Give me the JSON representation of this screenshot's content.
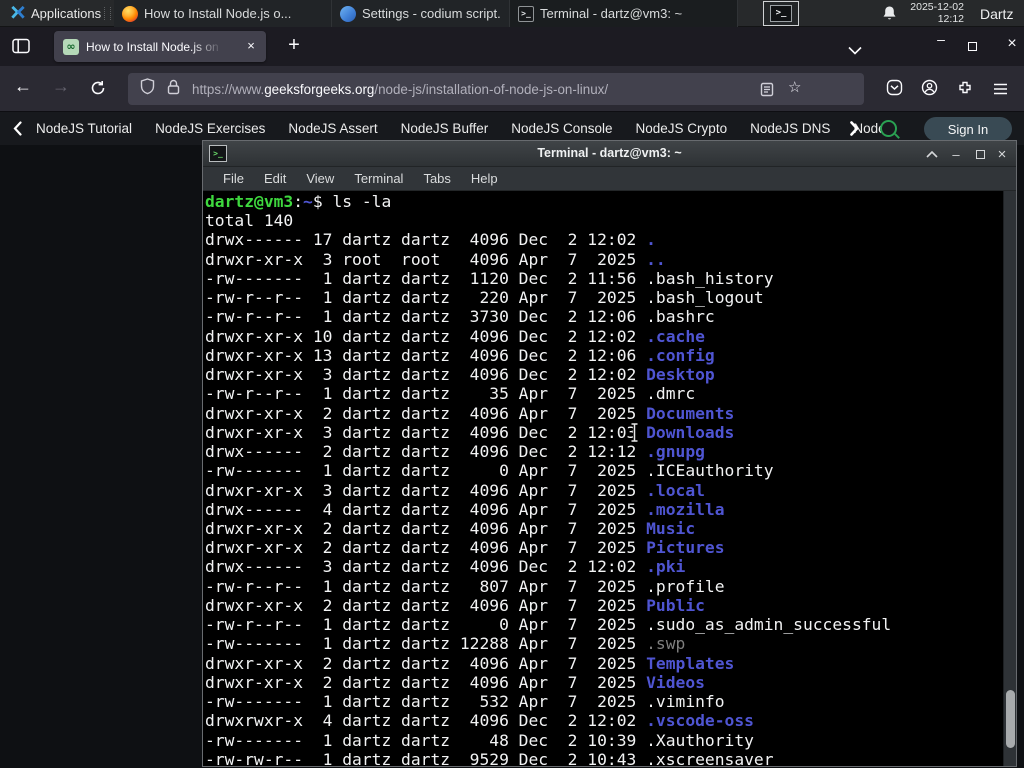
{
  "colors": {
    "accent_green": "#2aa152",
    "dir_blue": "#4f55d2",
    "prompt_green": "#3ed83e",
    "dim_file_gray": "#7f7f7f",
    "terminal_bg": "#000000",
    "panel_bg": "#27292b",
    "firefox_chrome_bg": "#2b2a33"
  },
  "panel": {
    "applications_label": "Applications",
    "windows": [
      {
        "title": "How to Install Node.js o...",
        "icon": "firefox",
        "active": false
      },
      {
        "title": "Settings - codium script...",
        "icon": "vscodium",
        "active": false
      },
      {
        "title": "Terminal - dartz@vm3: ~",
        "icon": "terminal",
        "active": true
      }
    ],
    "clock_date": "2025-12-02",
    "clock_time": "12:12",
    "user": "Dartz"
  },
  "browser": {
    "tab_title": "How to Install Node.js on",
    "tab_close_glyph": "×",
    "new_tab_glyph": "+",
    "back_glyph": "←",
    "forward_glyph": "→",
    "min_glyph": "–",
    "close_glyph": "×",
    "star_glyph": "☆",
    "favicon_glyph": "∞",
    "url": {
      "scheme": "https://www.",
      "domain": "geeksforgeeks.org",
      "path": "/node-js/installation-of-node-js-on-linux/"
    }
  },
  "site_nav": {
    "items": [
      "NodeJS Tutorial",
      "NodeJS Exercises",
      "NodeJS Assert",
      "NodeJS Buffer",
      "NodeJS Console",
      "NodeJS Crypto",
      "NodeJS DNS",
      "Node"
    ],
    "sign_in_label": "Sign In"
  },
  "terminal": {
    "window_title": "Terminal - dartz@vm3: ~",
    "icon_glyph": ">_",
    "min_glyph": "–",
    "close_glyph": "×",
    "menu_items": [
      "File",
      "Edit",
      "View",
      "Terminal",
      "Tabs",
      "Help"
    ],
    "prompt_userhost": "dartz@vm3",
    "prompt_separator": ":",
    "prompt_cwd": "~",
    "prompt_command": "ls -la",
    "total_line": "total 140",
    "listing": [
      {
        "perms": "drwx------",
        "links": "17",
        "owner": "dartz",
        "group": "dartz",
        "size": "4096",
        "month": "Dec",
        "day": "2",
        "when": "12:02",
        "name": ".",
        "type": "dir"
      },
      {
        "perms": "drwxr-xr-x",
        "links": "3",
        "owner": "root",
        "group": "root",
        "size": "4096",
        "month": "Apr",
        "day": "7",
        "when": "2025",
        "name": "..",
        "type": "dir"
      },
      {
        "perms": "-rw-------",
        "links": "1",
        "owner": "dartz",
        "group": "dartz",
        "size": "1120",
        "month": "Dec",
        "day": "2",
        "when": "11:56",
        "name": ".bash_history",
        "type": "file"
      },
      {
        "perms": "-rw-r--r--",
        "links": "1",
        "owner": "dartz",
        "group": "dartz",
        "size": "220",
        "month": "Apr",
        "day": "7",
        "when": "2025",
        "name": ".bash_logout",
        "type": "file"
      },
      {
        "perms": "-rw-r--r--",
        "links": "1",
        "owner": "dartz",
        "group": "dartz",
        "size": "3730",
        "month": "Dec",
        "day": "2",
        "when": "12:06",
        "name": ".bashrc",
        "type": "file"
      },
      {
        "perms": "drwxr-xr-x",
        "links": "10",
        "owner": "dartz",
        "group": "dartz",
        "size": "4096",
        "month": "Dec",
        "day": "2",
        "when": "12:02",
        "name": ".cache",
        "type": "dir"
      },
      {
        "perms": "drwxr-xr-x",
        "links": "13",
        "owner": "dartz",
        "group": "dartz",
        "size": "4096",
        "month": "Dec",
        "day": "2",
        "when": "12:06",
        "name": ".config",
        "type": "dir"
      },
      {
        "perms": "drwxr-xr-x",
        "links": "3",
        "owner": "dartz",
        "group": "dartz",
        "size": "4096",
        "month": "Dec",
        "day": "2",
        "when": "12:02",
        "name": "Desktop",
        "type": "dir"
      },
      {
        "perms": "-rw-r--r--",
        "links": "1",
        "owner": "dartz",
        "group": "dartz",
        "size": "35",
        "month": "Apr",
        "day": "7",
        "when": "2025",
        "name": ".dmrc",
        "type": "file"
      },
      {
        "perms": "drwxr-xr-x",
        "links": "2",
        "owner": "dartz",
        "group": "dartz",
        "size": "4096",
        "month": "Apr",
        "day": "7",
        "when": "2025",
        "name": "Documents",
        "type": "dir"
      },
      {
        "perms": "drwxr-xr-x",
        "links": "3",
        "owner": "dartz",
        "group": "dartz",
        "size": "4096",
        "month": "Dec",
        "day": "2",
        "when": "12:03",
        "name": "Downloads",
        "type": "dir"
      },
      {
        "perms": "drwx------",
        "links": "2",
        "owner": "dartz",
        "group": "dartz",
        "size": "4096",
        "month": "Dec",
        "day": "2",
        "when": "12:12",
        "name": ".gnupg",
        "type": "dir"
      },
      {
        "perms": "-rw-------",
        "links": "1",
        "owner": "dartz",
        "group": "dartz",
        "size": "0",
        "month": "Apr",
        "day": "7",
        "when": "2025",
        "name": ".ICEauthority",
        "type": "file"
      },
      {
        "perms": "drwxr-xr-x",
        "links": "3",
        "owner": "dartz",
        "group": "dartz",
        "size": "4096",
        "month": "Apr",
        "day": "7",
        "when": "2025",
        "name": ".local",
        "type": "dir"
      },
      {
        "perms": "drwx------",
        "links": "4",
        "owner": "dartz",
        "group": "dartz",
        "size": "4096",
        "month": "Apr",
        "day": "7",
        "when": "2025",
        "name": ".mozilla",
        "type": "dir"
      },
      {
        "perms": "drwxr-xr-x",
        "links": "2",
        "owner": "dartz",
        "group": "dartz",
        "size": "4096",
        "month": "Apr",
        "day": "7",
        "when": "2025",
        "name": "Music",
        "type": "dir"
      },
      {
        "perms": "drwxr-xr-x",
        "links": "2",
        "owner": "dartz",
        "group": "dartz",
        "size": "4096",
        "month": "Apr",
        "day": "7",
        "when": "2025",
        "name": "Pictures",
        "type": "dir"
      },
      {
        "perms": "drwx------",
        "links": "3",
        "owner": "dartz",
        "group": "dartz",
        "size": "4096",
        "month": "Dec",
        "day": "2",
        "when": "12:02",
        "name": ".pki",
        "type": "dir"
      },
      {
        "perms": "-rw-r--r--",
        "links": "1",
        "owner": "dartz",
        "group": "dartz",
        "size": "807",
        "month": "Apr",
        "day": "7",
        "when": "2025",
        "name": ".profile",
        "type": "file"
      },
      {
        "perms": "drwxr-xr-x",
        "links": "2",
        "owner": "dartz",
        "group": "dartz",
        "size": "4096",
        "month": "Apr",
        "day": "7",
        "when": "2025",
        "name": "Public",
        "type": "dir"
      },
      {
        "perms": "-rw-r--r--",
        "links": "1",
        "owner": "dartz",
        "group": "dartz",
        "size": "0",
        "month": "Apr",
        "day": "7",
        "when": "2025",
        "name": ".sudo_as_admin_successful",
        "type": "file"
      },
      {
        "perms": "-rw-------",
        "links": "1",
        "owner": "dartz",
        "group": "dartz",
        "size": "12288",
        "month": "Apr",
        "day": "7",
        "when": "2025",
        "name": ".swp",
        "type": "dim"
      },
      {
        "perms": "drwxr-xr-x",
        "links": "2",
        "owner": "dartz",
        "group": "dartz",
        "size": "4096",
        "month": "Apr",
        "day": "7",
        "when": "2025",
        "name": "Templates",
        "type": "dir"
      },
      {
        "perms": "drwxr-xr-x",
        "links": "2",
        "owner": "dartz",
        "group": "dartz",
        "size": "4096",
        "month": "Apr",
        "day": "7",
        "when": "2025",
        "name": "Videos",
        "type": "dir"
      },
      {
        "perms": "-rw-------",
        "links": "1",
        "owner": "dartz",
        "group": "dartz",
        "size": "532",
        "month": "Apr",
        "day": "7",
        "when": "2025",
        "name": ".viminfo",
        "type": "file"
      },
      {
        "perms": "drwxrwxr-x",
        "links": "4",
        "owner": "dartz",
        "group": "dartz",
        "size": "4096",
        "month": "Dec",
        "day": "2",
        "when": "12:02",
        "name": ".vscode-oss",
        "type": "dir"
      },
      {
        "perms": "-rw-------",
        "links": "1",
        "owner": "dartz",
        "group": "dartz",
        "size": "48",
        "month": "Dec",
        "day": "2",
        "when": "10:39",
        "name": ".Xauthority",
        "type": "file"
      },
      {
        "perms": "-rw-rw-r--",
        "links": "1",
        "owner": "dartz",
        "group": "dartz",
        "size": "9529",
        "month": "Dec",
        "day": "2",
        "when": "10:43",
        "name": ".xscreensaver",
        "type": "file"
      }
    ]
  }
}
